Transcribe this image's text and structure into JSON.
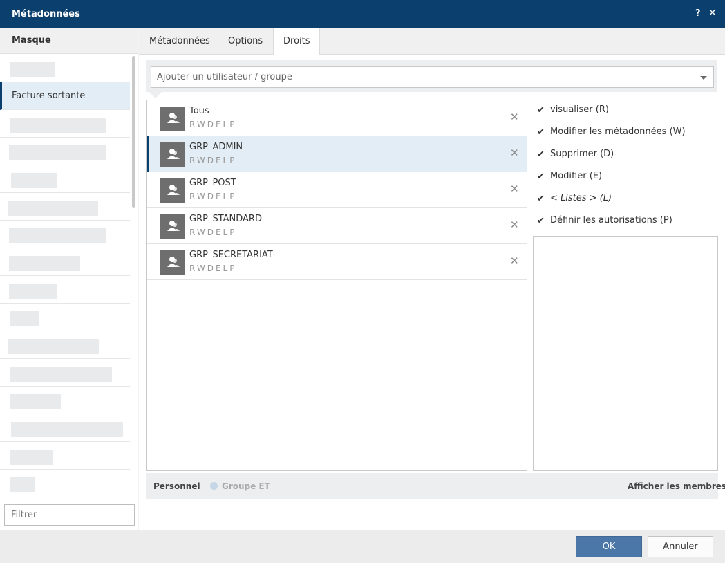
{
  "window": {
    "title": "Métadonnées",
    "help_label": "?",
    "close_label": "✕"
  },
  "left_panel": {
    "header": "Masque",
    "active_item": "Facture sortante",
    "filter_placeholder": "Filtrer"
  },
  "tabs": [
    {
      "label": "Métadonnées"
    },
    {
      "label": "Options"
    },
    {
      "label": "Droits"
    }
  ],
  "active_tab": "Droits",
  "add_user": {
    "placeholder": "Ajouter un utilisateur / groupe"
  },
  "users": [
    {
      "name": "Tous",
      "rights": "RWDELP",
      "selected": false
    },
    {
      "name": "GRP_ADMIN",
      "rights": "RWDELP",
      "selected": true
    },
    {
      "name": "GRP_POST",
      "rights": "RWDELP",
      "selected": false
    },
    {
      "name": "GRP_STANDARD",
      "rights": "RWDELP",
      "selected": false
    },
    {
      "name": "GRP_SECRETARIAT",
      "rights": "RWDELP",
      "selected": false
    }
  ],
  "permissions": [
    {
      "label": "visualiser (R)",
      "checked": true
    },
    {
      "label": "Modifier les métadonnées (W)",
      "checked": true
    },
    {
      "label": "Supprimer (D)",
      "checked": true
    },
    {
      "label": "Modifier (E)",
      "checked": true
    },
    {
      "label": "< Listes > (L)",
      "checked": true
    },
    {
      "label": "Définir les autorisations (P)",
      "checked": true
    }
  ],
  "bottom_bar": {
    "personnel": "Personnel",
    "groupe": "Groupe ET",
    "show_members": "Afficher les membres"
  },
  "footer": {
    "ok_label": "OK",
    "cancel_label": "Annuler"
  },
  "colors": {
    "titlebar": "#0b3f6e",
    "selection": "#e3edf5",
    "ok_button": "#4a76a8"
  }
}
